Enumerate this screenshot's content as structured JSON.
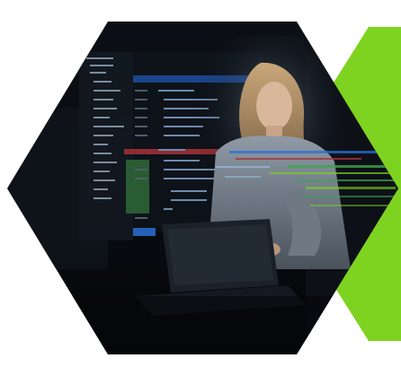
{
  "scene": {
    "subject": "woman-with-laptop",
    "colors": {
      "background": "#ffffff",
      "green_accent": "#7ed321",
      "hex_dark": "#0a0d12",
      "code_blue": "#1f4fa3",
      "code_highlight": "#2b6fd6",
      "code_red": "#a8323a",
      "code_green": "#3fa34d",
      "screen_glow": "#9fd4ff"
    }
  }
}
